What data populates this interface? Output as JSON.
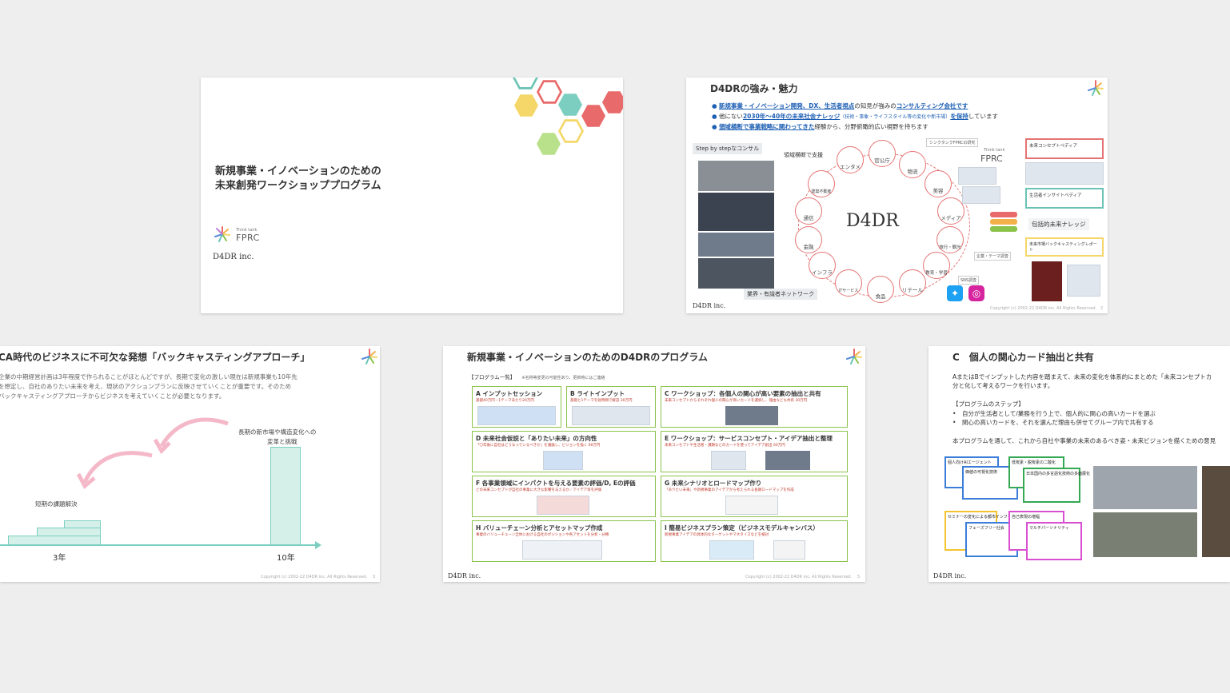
{
  "slide1": {
    "title_line1": "新規事業・イノベーションのための",
    "title_line2": "未来創発ワークショッププログラム",
    "fprc_small": "Think tank",
    "fprc_name": "FPRC",
    "d4dr_logo": "D4DR inc."
  },
  "slide2": {
    "title": "D4DRの強み・魅力",
    "bullets": [
      {
        "pre": "",
        "strong": "新規事業・イノベーション開発、DX、生活者視点",
        "mid": "の知見が強みの",
        "strong2": "コンサルティング会社です"
      },
      {
        "pre": "他にない",
        "strong": "2030年〜40年の未来社会ナレッジ",
        "mid": "（技術・事象・ライフスタイル等の変化や新市場）",
        "strong2": "を保持",
        "post": "しています"
      },
      {
        "pre": "",
        "strong": "領域横断で事業戦略に関わってきた",
        "mid": "経験から、分野俯瞰的広い視野を持ちます",
        "strong2": ""
      }
    ],
    "step_label": "Step by stepなコンサル",
    "cross_label": "領域横断で支援",
    "network_label": "業界・有識者ネットワーク",
    "center_logo": "D4DR",
    "ring_items": [
      "エンタメ",
      "官公庁",
      "物流",
      "美容",
      "メディア",
      "旅行・観光",
      "教育・学習",
      "リテール",
      "食品",
      "ITサービス",
      "インフラ",
      "金融",
      "通信",
      "建築不動産"
    ],
    "think_tank_label": "シンクタンクFPRCの研究",
    "think_tank_small": "Think tank",
    "think_tank_name": "FPRC",
    "knowledge_label": "包括的未来ナレッジ",
    "right_doc1": "未来コンセプトペディア",
    "right_doc2": "生活者インサイトペディア",
    "right_doc3": "未来市場バックキャスティングレポート",
    "sns_label": "SNS調査",
    "company_label": "企業・テーマ調査",
    "copyright": "Copyright (c) 2002-22 D4DR inc. All Rights Reserved.",
    "page": "2",
    "d4dr_logo": "D4DR inc."
  },
  "slide3": {
    "title": "CA時代のビジネスに不可欠な発想「バックキャスティングアプローチ」",
    "body_line1": "企業の中期経営計画は3年程度で作られることがほとんどですが、長期で変化の激しい現在は新規事業も10年先",
    "body_line2": "を想定し、自社のありたい未来を考え、現状のアクションプランに反映させていくことが重要です。そのため",
    "body_line3": "バックキャスティングアプローチからビジネスを考えていくことが必要となります。",
    "long_label_1": "長期の新市場や構造変化への",
    "long_label_2": "変革と挑戦",
    "short_label": "短期の課題解決",
    "x_label_1": "3年",
    "x_label_2": "10年",
    "copyright": "Copyright (c) 2002-22 D4DR inc. All Rights Reserved.",
    "page": "3"
  },
  "slide4": {
    "title": "新規事業・イノベーションのためのD4DRのプログラム",
    "list_label": "【プログラム一覧】",
    "list_note": "※名称等変更の可能性あり、更新時にはご連絡",
    "programs": [
      {
        "title": "A インプットセッション",
        "desc": "基礎40万円・1テーマあたり20万円"
      },
      {
        "title": "B ライトインプット",
        "desc": "基礎と1テーマを短時間で解説  30万円"
      },
      {
        "title": "C ワークショップ：各個人の関心が高い要素の抽出と共有",
        "desc": "未来コンセプトからそれぞれ個人の関心が高いカードを選択し、理由なども共有  30万円"
      },
      {
        "title": "D 未来社会仮説と「ありたい未来」の方向性",
        "desc": "「〇年後に自社はどうなっているべきか」を議論し、ビジョンを描く  60万円"
      },
      {
        "title": "E ワークショップ：サービスコンセプト・アイデア抽出と整理",
        "desc": "未来コンセプトや生活者・課題などのカードを使ってアイデア創出  60万円"
      },
      {
        "title": "F 各事業領域にインパクトを与える要素の評価/D, Eの評価",
        "desc": "どの未来コンセプトが自社の事業に大きな影響を与えるか／アイデア等を評価"
      },
      {
        "title": "G 未来シナリオとロードマップ作り",
        "desc": "「ありたい未来」や新規事業のアイデアから考えられる長期ロードマップを作成"
      },
      {
        "title": "H バリューチェーン分析とアセットマップ作成",
        "desc": "事業のバリューチェーン全体における自社のポジションや各アセットを分析・分類"
      },
      {
        "title": "I 簡易ビジネスプラン策定（ビジネスモデルキャンバス）",
        "desc": "新規事業アイデアの具体的なターゲットやマネタイズなどを検討"
      }
    ],
    "copyright": "Copyright (c) 2002-22 D4DR inc. All Rights Reserved.",
    "page": "5",
    "d4dr_logo": "D4DR inc."
  },
  "slide5": {
    "title": "C　個人の関心カード抽出と共有",
    "intro_line1": "AまたはBでインプットした内容を踏まえて、未来の変化を体系的にまとめた「未来コンセプトカ",
    "intro_line2": "分と化して考えるワークを行います。",
    "steps_label": "【プログラムのステップ】",
    "step1": "自分が生活者として/業務を行う上で、個人的に関心の高いカードを選ぶ",
    "step2": "関心の高いカードを、それを選んだ理由も併せてグループ内で共有する",
    "outro": "本プログラムを通して、これから自社や事業の未来のあるべき姿・未来ビジョンを描くための意見",
    "cards": [
      "個人向けAIエージェント",
      "価値の可視化技術",
      "低炭素・脱炭素の二酸化",
      "日本国内の多言語化技術の多面展化",
      "セミナーの変化による都市インフラの変容",
      "フェーズフリー社会",
      "自己表現の増幅",
      "マルチパーソナリティ"
    ],
    "d4dr_logo": "D4DR inc."
  }
}
